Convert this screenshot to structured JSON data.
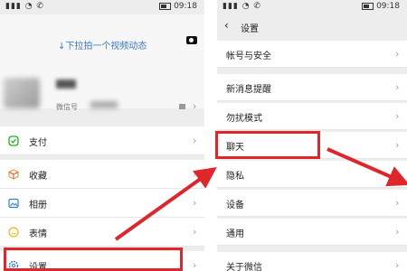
{
  "status_bar": {
    "time": "09:18"
  },
  "left_screen": {
    "pull_hint": "↓下拉拍一个视频动态",
    "wechat_id_label": "微信号",
    "menu": [
      {
        "label": "支付",
        "icon": "payment-icon"
      },
      {
        "label": "收藏",
        "icon": "favorites-cube-icon"
      },
      {
        "label": "相册",
        "icon": "photo-album-icon"
      },
      {
        "label": "表情",
        "icon": "sticker-smiley-icon"
      },
      {
        "label": "设置",
        "icon": "settings-gear-icon"
      }
    ]
  },
  "right_screen": {
    "title": "设置",
    "menu": [
      {
        "label": "帐号与安全"
      },
      {
        "label": "新消息提醒"
      },
      {
        "label": "勿扰模式"
      },
      {
        "label": "聊天"
      },
      {
        "label": "隐私"
      },
      {
        "label": "设备"
      },
      {
        "label": "通用"
      },
      {
        "label": "关于微信"
      }
    ]
  },
  "colors": {
    "highlight": "#e0262a",
    "link_blue": "#3b78c8",
    "payment_green": "#1aad19",
    "favorites_orange": "#f29c38",
    "album_blue": "#2b7fd6",
    "sticker_yellow": "#f2b31b"
  }
}
